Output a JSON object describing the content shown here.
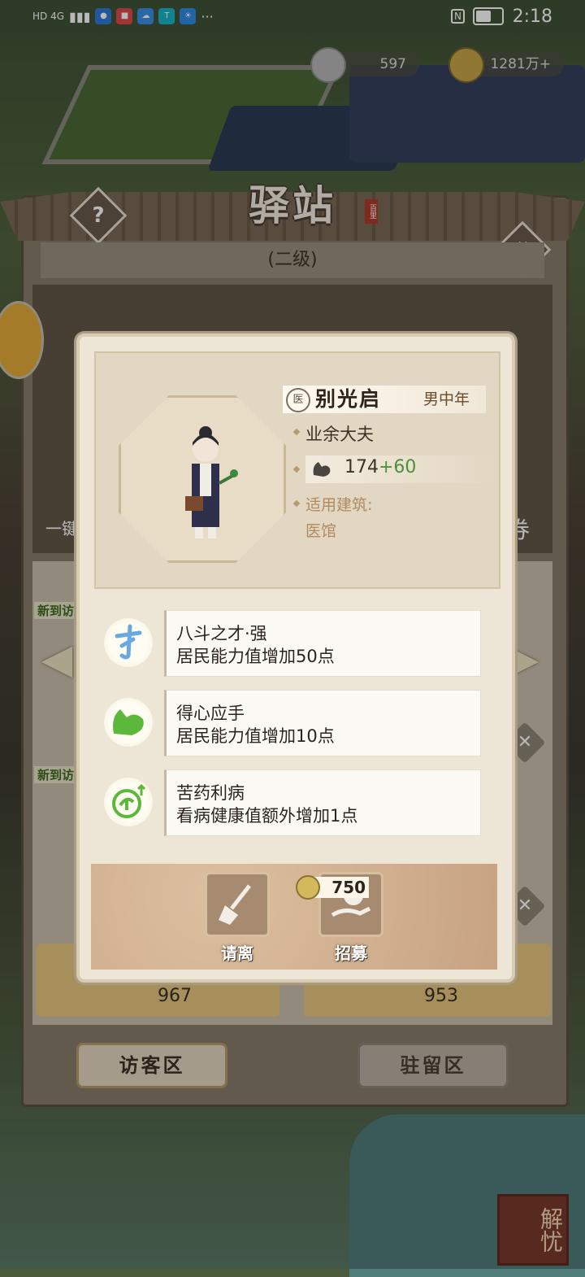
{
  "status_bar": {
    "network": "HD 4G",
    "time": "2:18"
  },
  "currency": {
    "silver": "597",
    "copper": "1281万+"
  },
  "header": {
    "title": "驿站",
    "seal": "百里",
    "level": "(二级)"
  },
  "background": {
    "left_prefix": "一键",
    "ticket": "券",
    "new_arrival_tags": [
      "新到访",
      "新到访"
    ],
    "visitor_cards": [
      {
        "ability": "967"
      },
      {
        "ability": "953"
      }
    ]
  },
  "tabs": {
    "visitor": "访客区",
    "resident": "驻留区"
  },
  "corner_button": "解忧",
  "modal": {
    "character": {
      "badge": "医",
      "name": "别光启",
      "gender_age": "男中年",
      "occupation": "业余大夫",
      "ability_base": "174",
      "ability_bonus": "+60",
      "building_label": "适用建筑:",
      "building": "医馆"
    },
    "skills": [
      {
        "icon": "talent-icon",
        "name": "八斗之才·强",
        "desc": "居民能力值增加50点"
      },
      {
        "icon": "strength-icon",
        "name": "得心应手",
        "desc": "居民能力值增加10点"
      },
      {
        "icon": "herb-icon",
        "name": "苦药利病",
        "desc": "看病健康值额外增加1点"
      }
    ],
    "actions": {
      "dismiss": "请离",
      "recruit": "招募",
      "recruit_cost": "750"
    }
  },
  "colors": {
    "modal_bg": "#ede5d5",
    "bonus_green": "#4f8f3a",
    "building_text": "#b08a60"
  }
}
